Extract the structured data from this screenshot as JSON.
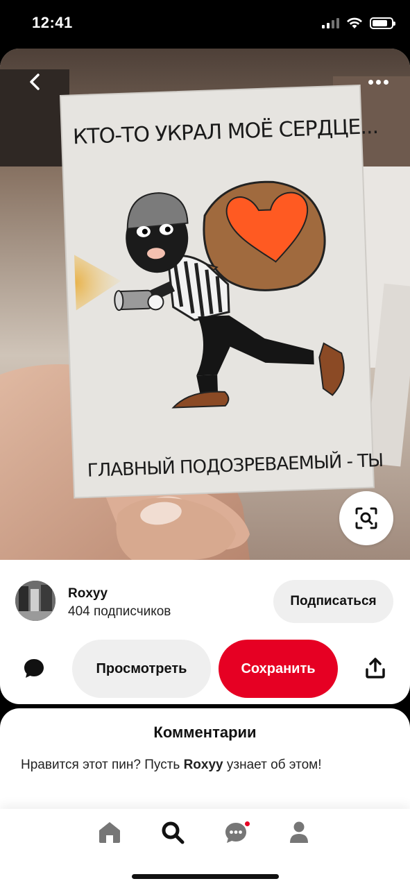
{
  "status_bar": {
    "time": "12:41",
    "battery_level": 0.8
  },
  "pin": {
    "card_text_top": "КТО-ТО УКРАЛ МОЁ СЕРДЦЕ...",
    "card_text_bottom": "ГЛАВНЫЙ ПОДОЗРЕВАЕМЫЙ - ТЫ",
    "icons": {
      "back": "chevron-left-icon",
      "more": "more-dots-icon",
      "lens": "visual-search-icon"
    }
  },
  "author": {
    "name": "Roxyy",
    "followers": "404 подписчиков",
    "follow_label": "Подписаться"
  },
  "actions": {
    "view_label": "Просмотреть",
    "save_label": "Сохранить",
    "save_color": "#e60023",
    "icons": {
      "comment": "comment-bubble-icon",
      "share": "share-upload-icon"
    }
  },
  "comments": {
    "title": "Комментарии",
    "prompt_before": "Нравится этот пин? Пусть ",
    "prompt_name": "Roxyy",
    "prompt_after": " узнает об этом!"
  },
  "tab_bar": {
    "icons": [
      "home-icon",
      "search-icon",
      "messages-icon",
      "profile-icon"
    ],
    "messages_has_notification": true
  }
}
